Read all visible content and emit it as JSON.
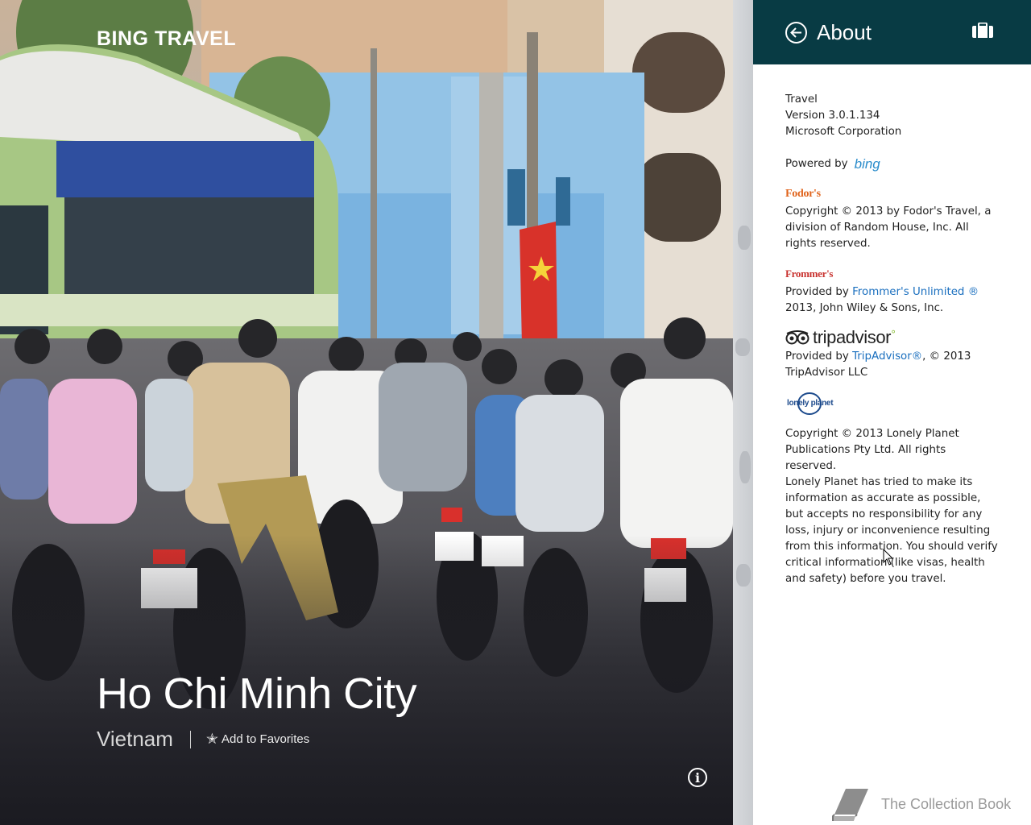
{
  "app": {
    "title": "BING TRAVEL"
  },
  "destination": {
    "city": "Ho Chi Minh City",
    "country": "Vietnam",
    "favorites_label": "Add to Favorites",
    "favorites_icon": "star-icon",
    "info_icon": "info-icon"
  },
  "about_pane": {
    "header_color": "#083b44",
    "title": "About",
    "back_icon": "back-arrow-icon",
    "luggage_icon": "luggage-icon",
    "app_name": "Travel",
    "version": "Version 3.0.1.134",
    "publisher": "Microsoft Corporation",
    "powered_by": "Powered by",
    "bing_logo": "bing",
    "fodors": {
      "logo": "Fodor's",
      "text": "Copyright © 2013 by Fodor's Travel, a division of Random House, Inc. All rights reserved."
    },
    "frommers": {
      "logo": "Frommer's",
      "prefix": "Provided by",
      "link": "Frommer's Unlimited ®",
      "suffix": "2013, John Wiley & Sons, Inc."
    },
    "tripadvisor": {
      "logo": "tripadvisor",
      "prefix": "Provided by",
      "link": "TripAdvisor®",
      "suffix": ", © 2013 TripAdvisor LLC"
    },
    "lonely_planet": {
      "logo": "lonely planet",
      "copyright": "Copyright © 2013 Lonely Planet Publications Pty Ltd. All rights reserved.",
      "disclaimer": "Lonely Planet has tried to make its information as accurate as possible, but accepts no responsibility for any loss, injury or inconvenience resulting from this information. You should verify critical information (like visas, health and safety) before you travel."
    }
  },
  "taskbar_item": {
    "label": "The Collection Book",
    "icon": "book-icon"
  }
}
